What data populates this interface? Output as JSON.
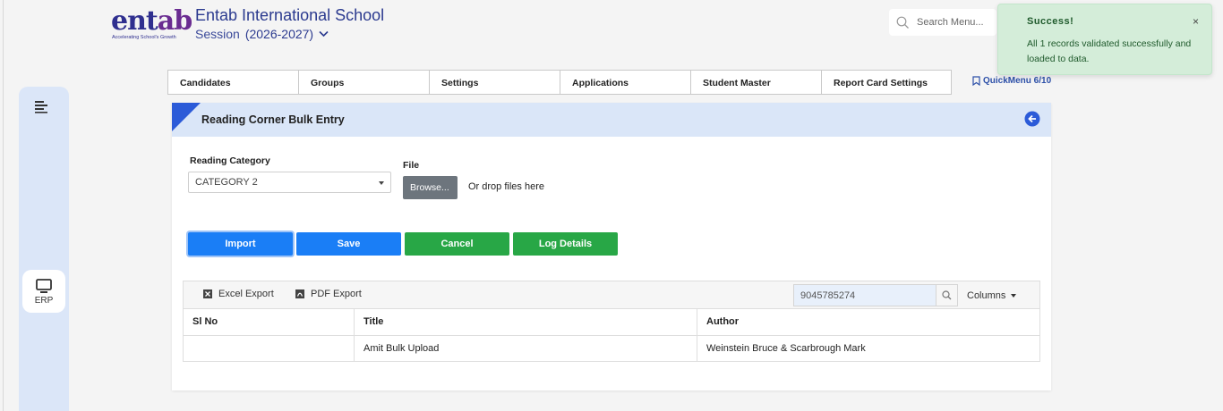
{
  "header": {
    "logo_text_1": "ent",
    "logo_text_2": "ab",
    "logo_tagline": "Accelerating School's Growth",
    "school_name": "Entab International School",
    "session_label": "Session",
    "session_year": "(2026-2027)",
    "search_placeholder": "Search Menu..."
  },
  "rail": {
    "erp_label": "ERP"
  },
  "tabs": [
    {
      "label": "Candidates"
    },
    {
      "label": "Groups"
    },
    {
      "label": "Settings"
    },
    {
      "label": "Applications"
    },
    {
      "label": "Student Master"
    },
    {
      "label": "Report Card Settings"
    }
  ],
  "quickmenu": "QuickMenu 6/10",
  "card": {
    "title": "Reading Corner Bulk Entry",
    "category_label": "Reading Category",
    "category_value": "CATEGORY 2",
    "file_label": "File",
    "browse_label": "Browse...",
    "drop_text": "Or drop files here",
    "buttons": {
      "import": "Import",
      "save": "Save",
      "cancel": "Cancel",
      "log": "Log Details"
    }
  },
  "grid": {
    "excel_export": "Excel Export",
    "pdf_export": "PDF Export",
    "search_value": "9045785274",
    "columns_label": "Columns",
    "headers": [
      "Sl No",
      "Title",
      "Author"
    ],
    "rows": [
      [
        "",
        "Amit Bulk Upload",
        "Weinstein Bruce & Scarbrough Mark"
      ]
    ]
  },
  "toast": {
    "title": "Success!",
    "close": "×",
    "message": "All 1 records validated successfully and loaded to data."
  },
  "colors": {
    "primary": "#1a7ef6",
    "success": "#28a746",
    "brand": "#2f2f8f",
    "header_band": "#dae6f8"
  }
}
